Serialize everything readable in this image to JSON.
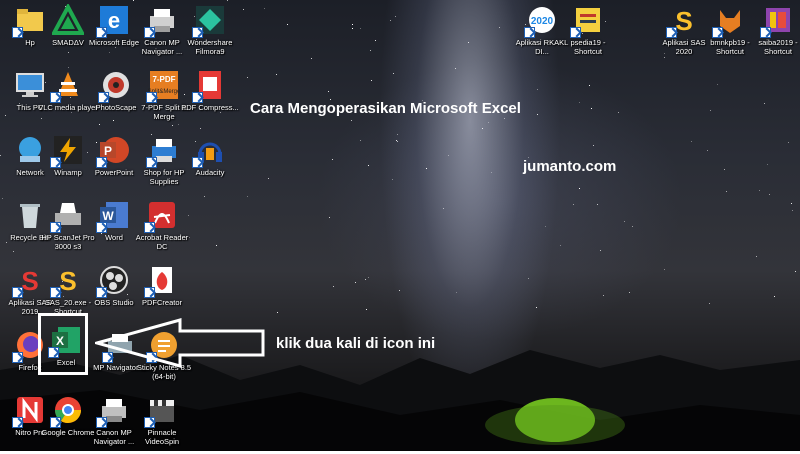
{
  "desktop": {
    "title": "Cara Mengoperasikan Microsoft Excel",
    "site": "jumanto.com",
    "hint": "klik dua kali di icon ini"
  },
  "icons": [
    {
      "id": "hp",
      "label": "Hp",
      "glyph": "folder",
      "color": "#f2c94c"
    },
    {
      "id": "smadav",
      "label": "SMADΔV",
      "glyph": "triangle",
      "color": "#1fa84f"
    },
    {
      "id": "edge",
      "label": "Microsoft Edge",
      "glyph": "e",
      "color": "#1e7bd8"
    },
    {
      "id": "canon1",
      "label": "Canon MP Navigator ...",
      "glyph": "printer",
      "color": "#d0d0d0"
    },
    {
      "id": "filmora",
      "label": "Wondershare Filmora9",
      "glyph": "diamond",
      "color": "#2bc3a0"
    },
    {
      "id": "thispc",
      "label": "This PC",
      "glyph": "monitor",
      "color": "#3b8fd9"
    },
    {
      "id": "vlc",
      "label": "VLC media player",
      "glyph": "cone",
      "color": "#f08a1c"
    },
    {
      "id": "photoscape",
      "label": "PhotoScape",
      "glyph": "circle",
      "color": "#c0392b"
    },
    {
      "id": "7pdf",
      "label": "7-PDF Split & Merge",
      "glyph": "text",
      "color": "#e67e22"
    },
    {
      "id": "pdfcompress",
      "label": "PDF Compress...",
      "glyph": "doc",
      "color": "#e53935"
    },
    {
      "id": "network",
      "label": "Network",
      "glyph": "globe",
      "color": "#3aa0e0"
    },
    {
      "id": "winamp",
      "label": "Winamp",
      "glyph": "bolt",
      "color": "#f0a500"
    },
    {
      "id": "powerpoint",
      "label": "PowerPoint",
      "glyph": "P",
      "color": "#d24726"
    },
    {
      "id": "shophp",
      "label": "Shop for HP Supplies",
      "glyph": "printer",
      "color": "#2d7dd2"
    },
    {
      "id": "audacity",
      "label": "Audacity",
      "glyph": "headphones",
      "color": "#f39c12"
    },
    {
      "id": "recyclebin",
      "label": "Recycle Bin",
      "glyph": "bin",
      "color": "#cfd8dc"
    },
    {
      "id": "hpscanjet",
      "label": "HP ScanJet Pro 3000 s3",
      "glyph": "scanner",
      "color": "#b0b0b0"
    },
    {
      "id": "word",
      "label": "Word",
      "glyph": "W",
      "color": "#2b579a"
    },
    {
      "id": "acrobat",
      "label": "Acrobat Reader DC",
      "glyph": "A",
      "color": "#d32f2f"
    },
    {
      "id": "aplikasisas2019",
      "label": "Aplikasi SAS 2019",
      "glyph": "S",
      "color": "#e53935"
    },
    {
      "id": "sas20",
      "label": "SAS_20.exe - Shortcut",
      "glyph": "S",
      "color": "#1e88e5"
    },
    {
      "id": "obs",
      "label": "OBS Studio",
      "glyph": "obs",
      "color": "#222"
    },
    {
      "id": "pdfcreator",
      "label": "PDFCreator",
      "glyph": "flame",
      "color": "#e53935"
    },
    {
      "id": "firefox",
      "label": "Firefox",
      "glyph": "fox",
      "color": "#ff7139"
    },
    {
      "id": "excel",
      "label": "Excel",
      "glyph": "X",
      "color": "#1d6f42"
    },
    {
      "id": "mpnavigator",
      "label": "MP Navigator ...",
      "glyph": "printer",
      "color": "#90a4ae"
    },
    {
      "id": "stickynotes",
      "label": "Sticky Notes 8.5 (64-bit)",
      "glyph": "sticky",
      "color": "#f0a030"
    },
    {
      "id": "nitro",
      "label": "Nitro Pro",
      "glyph": "N",
      "color": "#e53935"
    },
    {
      "id": "chrome",
      "label": "Google Chrome",
      "glyph": "chrome",
      "color": "#fbbc05"
    },
    {
      "id": "canon2",
      "label": "Canon MP Navigator ...",
      "glyph": "printer",
      "color": "#c0c0c0"
    },
    {
      "id": "pinnacle",
      "label": "Pinnacle VideoSpin",
      "glyph": "clap",
      "color": "#555"
    },
    {
      "id": "rkakl",
      "label": "Aplikasi RKAKL DI...",
      "glyph": "2020",
      "color": "#1e88e5"
    },
    {
      "id": "psedia",
      "label": "psedia19 - Shortcut",
      "glyph": "note",
      "color": "#f4d03f"
    },
    {
      "id": "sas2020",
      "label": "Aplikasi SAS 2020",
      "glyph": "S",
      "color": "#fbc02d"
    },
    {
      "id": "bmnkpb",
      "label": "bmnkpb19 - Shortcut",
      "glyph": "fox",
      "color": "#e67e22"
    },
    {
      "id": "saiba",
      "label": "saiba2019 - Shortcut",
      "glyph": "book",
      "color": "#8e44ad"
    }
  ]
}
